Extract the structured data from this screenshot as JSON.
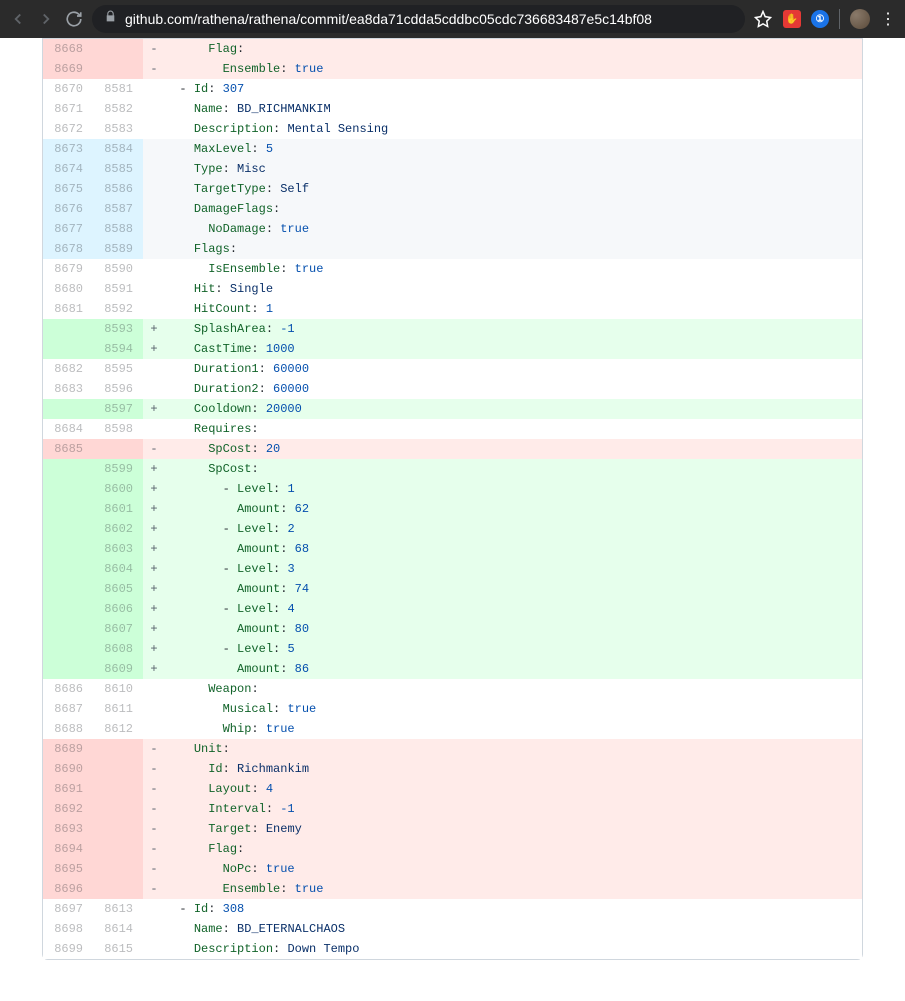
{
  "browser": {
    "url": "github.com/rathena/rathena/commit/ea8da71cdda5cddbc05cdc736683487e5c14bf08"
  },
  "diff": {
    "rows": [
      {
        "t": "del",
        "old": "8668",
        "new": "",
        "m": "-",
        "seg": [
          {
            "txt": "      "
          },
          {
            "cls": "pl-ent",
            "txt": "Flag"
          },
          {
            "txt": ":"
          }
        ]
      },
      {
        "t": "del",
        "old": "8669",
        "new": "",
        "m": "-",
        "seg": [
          {
            "txt": "        "
          },
          {
            "cls": "pl-ent",
            "txt": "Ensemble"
          },
          {
            "txt": ": "
          },
          {
            "cls": "pl-c1",
            "txt": "true"
          }
        ]
      },
      {
        "t": "ctx",
        "old": "8670",
        "new": "8581",
        "m": " ",
        "seg": [
          {
            "txt": "  - "
          },
          {
            "cls": "pl-ent",
            "txt": "Id"
          },
          {
            "txt": ": "
          },
          {
            "cls": "pl-c1",
            "txt": "307"
          }
        ]
      },
      {
        "t": "ctx",
        "old": "8671",
        "new": "8582",
        "m": " ",
        "seg": [
          {
            "txt": "    "
          },
          {
            "cls": "pl-ent",
            "txt": "Name"
          },
          {
            "txt": ": "
          },
          {
            "cls": "pl-s",
            "txt": "BD_RICHMANKIM"
          }
        ]
      },
      {
        "t": "ctx",
        "old": "8672",
        "new": "8583",
        "m": " ",
        "seg": [
          {
            "txt": "    "
          },
          {
            "cls": "pl-ent",
            "txt": "Description"
          },
          {
            "txt": ": "
          },
          {
            "cls": "pl-s",
            "txt": "Mental Sensing"
          }
        ]
      },
      {
        "t": "hunk",
        "old": "8673",
        "new": "8584",
        "m": " ",
        "seg": [
          {
            "txt": "    "
          },
          {
            "cls": "pl-ent",
            "txt": "MaxLevel"
          },
          {
            "txt": ": "
          },
          {
            "cls": "pl-c1",
            "txt": "5"
          }
        ]
      },
      {
        "t": "hunk",
        "old": "8674",
        "new": "8585",
        "m": " ",
        "seg": [
          {
            "txt": "    "
          },
          {
            "cls": "pl-ent",
            "txt": "Type"
          },
          {
            "txt": ": "
          },
          {
            "cls": "pl-s",
            "txt": "Misc"
          }
        ]
      },
      {
        "t": "hunk",
        "old": "8675",
        "new": "8586",
        "m": " ",
        "seg": [
          {
            "txt": "    "
          },
          {
            "cls": "pl-ent",
            "txt": "TargetType"
          },
          {
            "txt": ": "
          },
          {
            "cls": "pl-s",
            "txt": "Self"
          }
        ]
      },
      {
        "t": "hunk",
        "old": "8676",
        "new": "8587",
        "m": " ",
        "seg": [
          {
            "txt": "    "
          },
          {
            "cls": "pl-ent",
            "txt": "DamageFlags"
          },
          {
            "txt": ":"
          }
        ]
      },
      {
        "t": "hunk",
        "old": "8677",
        "new": "8588",
        "m": " ",
        "seg": [
          {
            "txt": "      "
          },
          {
            "cls": "pl-ent",
            "txt": "NoDamage"
          },
          {
            "txt": ": "
          },
          {
            "cls": "pl-c1",
            "txt": "true"
          }
        ]
      },
      {
        "t": "hunk",
        "old": "8678",
        "new": "8589",
        "m": " ",
        "seg": [
          {
            "txt": "    "
          },
          {
            "cls": "pl-ent",
            "txt": "Flags"
          },
          {
            "txt": ":"
          }
        ]
      },
      {
        "t": "ctx",
        "old": "8679",
        "new": "8590",
        "m": " ",
        "seg": [
          {
            "txt": "      "
          },
          {
            "cls": "pl-ent",
            "txt": "IsEnsemble"
          },
          {
            "txt": ": "
          },
          {
            "cls": "pl-c1",
            "txt": "true"
          }
        ]
      },
      {
        "t": "ctx",
        "old": "8680",
        "new": "8591",
        "m": " ",
        "seg": [
          {
            "txt": "    "
          },
          {
            "cls": "pl-ent",
            "txt": "Hit"
          },
          {
            "txt": ": "
          },
          {
            "cls": "pl-s",
            "txt": "Single"
          }
        ]
      },
      {
        "t": "ctx",
        "old": "8681",
        "new": "8592",
        "m": " ",
        "seg": [
          {
            "txt": "    "
          },
          {
            "cls": "pl-ent",
            "txt": "HitCount"
          },
          {
            "txt": ": "
          },
          {
            "cls": "pl-c1",
            "txt": "1"
          }
        ]
      },
      {
        "t": "add",
        "old": "",
        "new": "8593",
        "m": "+",
        "seg": [
          {
            "txt": "    "
          },
          {
            "cls": "pl-ent",
            "txt": "SplashArea"
          },
          {
            "txt": ": "
          },
          {
            "cls": "pl-c1",
            "txt": "-1"
          }
        ]
      },
      {
        "t": "add",
        "old": "",
        "new": "8594",
        "m": "+",
        "seg": [
          {
            "txt": "    "
          },
          {
            "cls": "pl-ent",
            "txt": "CastTime"
          },
          {
            "txt": ": "
          },
          {
            "cls": "pl-c1",
            "txt": "1000"
          }
        ]
      },
      {
        "t": "ctx",
        "old": "8682",
        "new": "8595",
        "m": " ",
        "seg": [
          {
            "txt": "    "
          },
          {
            "cls": "pl-ent",
            "txt": "Duration1"
          },
          {
            "txt": ": "
          },
          {
            "cls": "pl-c1",
            "txt": "60000"
          }
        ]
      },
      {
        "t": "ctx",
        "old": "8683",
        "new": "8596",
        "m": " ",
        "seg": [
          {
            "txt": "    "
          },
          {
            "cls": "pl-ent",
            "txt": "Duration2"
          },
          {
            "txt": ": "
          },
          {
            "cls": "pl-c1",
            "txt": "60000"
          }
        ]
      },
      {
        "t": "add",
        "old": "",
        "new": "8597",
        "m": "+",
        "seg": [
          {
            "txt": "    "
          },
          {
            "cls": "pl-ent",
            "txt": "Cooldown"
          },
          {
            "txt": ": "
          },
          {
            "cls": "pl-c1",
            "txt": "20000"
          }
        ]
      },
      {
        "t": "ctx",
        "old": "8684",
        "new": "8598",
        "m": " ",
        "seg": [
          {
            "txt": "    "
          },
          {
            "cls": "pl-ent",
            "txt": "Requires"
          },
          {
            "txt": ":"
          }
        ]
      },
      {
        "t": "del",
        "old": "8685",
        "new": "",
        "m": "-",
        "seg": [
          {
            "txt": "      "
          },
          {
            "cls": "pl-ent",
            "txt": "SpCost"
          },
          {
            "txt": ": "
          },
          {
            "cls": "pl-c1",
            "txt": "20"
          }
        ]
      },
      {
        "t": "add",
        "old": "",
        "new": "8599",
        "m": "+",
        "seg": [
          {
            "txt": "      "
          },
          {
            "cls": "pl-ent",
            "txt": "SpCost"
          },
          {
            "txt": ":"
          }
        ]
      },
      {
        "t": "add",
        "old": "",
        "new": "8600",
        "m": "+",
        "seg": [
          {
            "txt": "        - "
          },
          {
            "cls": "pl-ent",
            "txt": "Level"
          },
          {
            "txt": ": "
          },
          {
            "cls": "pl-c1",
            "txt": "1"
          }
        ]
      },
      {
        "t": "add",
        "old": "",
        "new": "8601",
        "m": "+",
        "seg": [
          {
            "txt": "          "
          },
          {
            "cls": "pl-ent",
            "txt": "Amount"
          },
          {
            "txt": ": "
          },
          {
            "cls": "pl-c1",
            "txt": "62"
          }
        ]
      },
      {
        "t": "add",
        "old": "",
        "new": "8602",
        "m": "+",
        "seg": [
          {
            "txt": "        - "
          },
          {
            "cls": "pl-ent",
            "txt": "Level"
          },
          {
            "txt": ": "
          },
          {
            "cls": "pl-c1",
            "txt": "2"
          }
        ]
      },
      {
        "t": "add",
        "old": "",
        "new": "8603",
        "m": "+",
        "seg": [
          {
            "txt": "          "
          },
          {
            "cls": "pl-ent",
            "txt": "Amount"
          },
          {
            "txt": ": "
          },
          {
            "cls": "pl-c1",
            "txt": "68"
          }
        ]
      },
      {
        "t": "add",
        "old": "",
        "new": "8604",
        "m": "+",
        "seg": [
          {
            "txt": "        - "
          },
          {
            "cls": "pl-ent",
            "txt": "Level"
          },
          {
            "txt": ": "
          },
          {
            "cls": "pl-c1",
            "txt": "3"
          }
        ]
      },
      {
        "t": "add",
        "old": "",
        "new": "8605",
        "m": "+",
        "seg": [
          {
            "txt": "          "
          },
          {
            "cls": "pl-ent",
            "txt": "Amount"
          },
          {
            "txt": ": "
          },
          {
            "cls": "pl-c1",
            "txt": "74"
          }
        ]
      },
      {
        "t": "add",
        "old": "",
        "new": "8606",
        "m": "+",
        "seg": [
          {
            "txt": "        - "
          },
          {
            "cls": "pl-ent",
            "txt": "Level"
          },
          {
            "txt": ": "
          },
          {
            "cls": "pl-c1",
            "txt": "4"
          }
        ]
      },
      {
        "t": "add",
        "old": "",
        "new": "8607",
        "m": "+",
        "seg": [
          {
            "txt": "          "
          },
          {
            "cls": "pl-ent",
            "txt": "Amount"
          },
          {
            "txt": ": "
          },
          {
            "cls": "pl-c1",
            "txt": "80"
          }
        ]
      },
      {
        "t": "add",
        "old": "",
        "new": "8608",
        "m": "+",
        "seg": [
          {
            "txt": "        - "
          },
          {
            "cls": "pl-ent",
            "txt": "Level"
          },
          {
            "txt": ": "
          },
          {
            "cls": "pl-c1",
            "txt": "5"
          }
        ]
      },
      {
        "t": "add",
        "old": "",
        "new": "8609",
        "m": "+",
        "seg": [
          {
            "txt": "          "
          },
          {
            "cls": "pl-ent",
            "txt": "Amount"
          },
          {
            "txt": ": "
          },
          {
            "cls": "pl-c1",
            "txt": "86"
          }
        ]
      },
      {
        "t": "ctx",
        "old": "8686",
        "new": "8610",
        "m": " ",
        "seg": [
          {
            "txt": "      "
          },
          {
            "cls": "pl-ent",
            "txt": "Weapon"
          },
          {
            "txt": ":"
          }
        ]
      },
      {
        "t": "ctx",
        "old": "8687",
        "new": "8611",
        "m": " ",
        "seg": [
          {
            "txt": "        "
          },
          {
            "cls": "pl-ent",
            "txt": "Musical"
          },
          {
            "txt": ": "
          },
          {
            "cls": "pl-c1",
            "txt": "true"
          }
        ]
      },
      {
        "t": "ctx",
        "old": "8688",
        "new": "8612",
        "m": " ",
        "seg": [
          {
            "txt": "        "
          },
          {
            "cls": "pl-ent",
            "txt": "Whip"
          },
          {
            "txt": ": "
          },
          {
            "cls": "pl-c1",
            "txt": "true"
          }
        ]
      },
      {
        "t": "del",
        "old": "8689",
        "new": "",
        "m": "-",
        "seg": [
          {
            "txt": "    "
          },
          {
            "cls": "pl-ent",
            "txt": "Unit"
          },
          {
            "txt": ":"
          }
        ]
      },
      {
        "t": "del",
        "old": "8690",
        "new": "",
        "m": "-",
        "seg": [
          {
            "txt": "      "
          },
          {
            "cls": "pl-ent",
            "txt": "Id"
          },
          {
            "txt": ": "
          },
          {
            "cls": "pl-s",
            "txt": "Richmankim"
          }
        ]
      },
      {
        "t": "del",
        "old": "8691",
        "new": "",
        "m": "-",
        "seg": [
          {
            "txt": "      "
          },
          {
            "cls": "pl-ent",
            "txt": "Layout"
          },
          {
            "txt": ": "
          },
          {
            "cls": "pl-c1",
            "txt": "4"
          }
        ]
      },
      {
        "t": "del",
        "old": "8692",
        "new": "",
        "m": "-",
        "seg": [
          {
            "txt": "      "
          },
          {
            "cls": "pl-ent",
            "txt": "Interval"
          },
          {
            "txt": ": "
          },
          {
            "cls": "pl-c1",
            "txt": "-1"
          }
        ]
      },
      {
        "t": "del",
        "old": "8693",
        "new": "",
        "m": "-",
        "seg": [
          {
            "txt": "      "
          },
          {
            "cls": "pl-ent",
            "txt": "Target"
          },
          {
            "txt": ": "
          },
          {
            "cls": "pl-s",
            "txt": "Enemy"
          }
        ]
      },
      {
        "t": "del",
        "old": "8694",
        "new": "",
        "m": "-",
        "seg": [
          {
            "txt": "      "
          },
          {
            "cls": "pl-ent",
            "txt": "Flag"
          },
          {
            "txt": ":"
          }
        ]
      },
      {
        "t": "del",
        "old": "8695",
        "new": "",
        "m": "-",
        "seg": [
          {
            "txt": "        "
          },
          {
            "cls": "pl-ent",
            "txt": "NoPc"
          },
          {
            "txt": ": "
          },
          {
            "cls": "pl-c1",
            "txt": "true"
          }
        ]
      },
      {
        "t": "del",
        "old": "8696",
        "new": "",
        "m": "-",
        "seg": [
          {
            "txt": "        "
          },
          {
            "cls": "pl-ent",
            "txt": "Ensemble"
          },
          {
            "txt": ": "
          },
          {
            "cls": "pl-c1",
            "txt": "true"
          }
        ]
      },
      {
        "t": "ctx",
        "old": "8697",
        "new": "8613",
        "m": " ",
        "seg": [
          {
            "txt": "  - "
          },
          {
            "cls": "pl-ent",
            "txt": "Id"
          },
          {
            "txt": ": "
          },
          {
            "cls": "pl-c1",
            "txt": "308"
          }
        ]
      },
      {
        "t": "ctx",
        "old": "8698",
        "new": "8614",
        "m": " ",
        "seg": [
          {
            "txt": "    "
          },
          {
            "cls": "pl-ent",
            "txt": "Name"
          },
          {
            "txt": ": "
          },
          {
            "cls": "pl-s",
            "txt": "BD_ETERNALCHAOS"
          }
        ]
      },
      {
        "t": "ctx",
        "old": "8699",
        "new": "8615",
        "m": " ",
        "seg": [
          {
            "txt": "    "
          },
          {
            "cls": "pl-ent",
            "txt": "Description"
          },
          {
            "txt": ": "
          },
          {
            "cls": "pl-s",
            "txt": "Down Tempo"
          }
        ]
      }
    ]
  }
}
